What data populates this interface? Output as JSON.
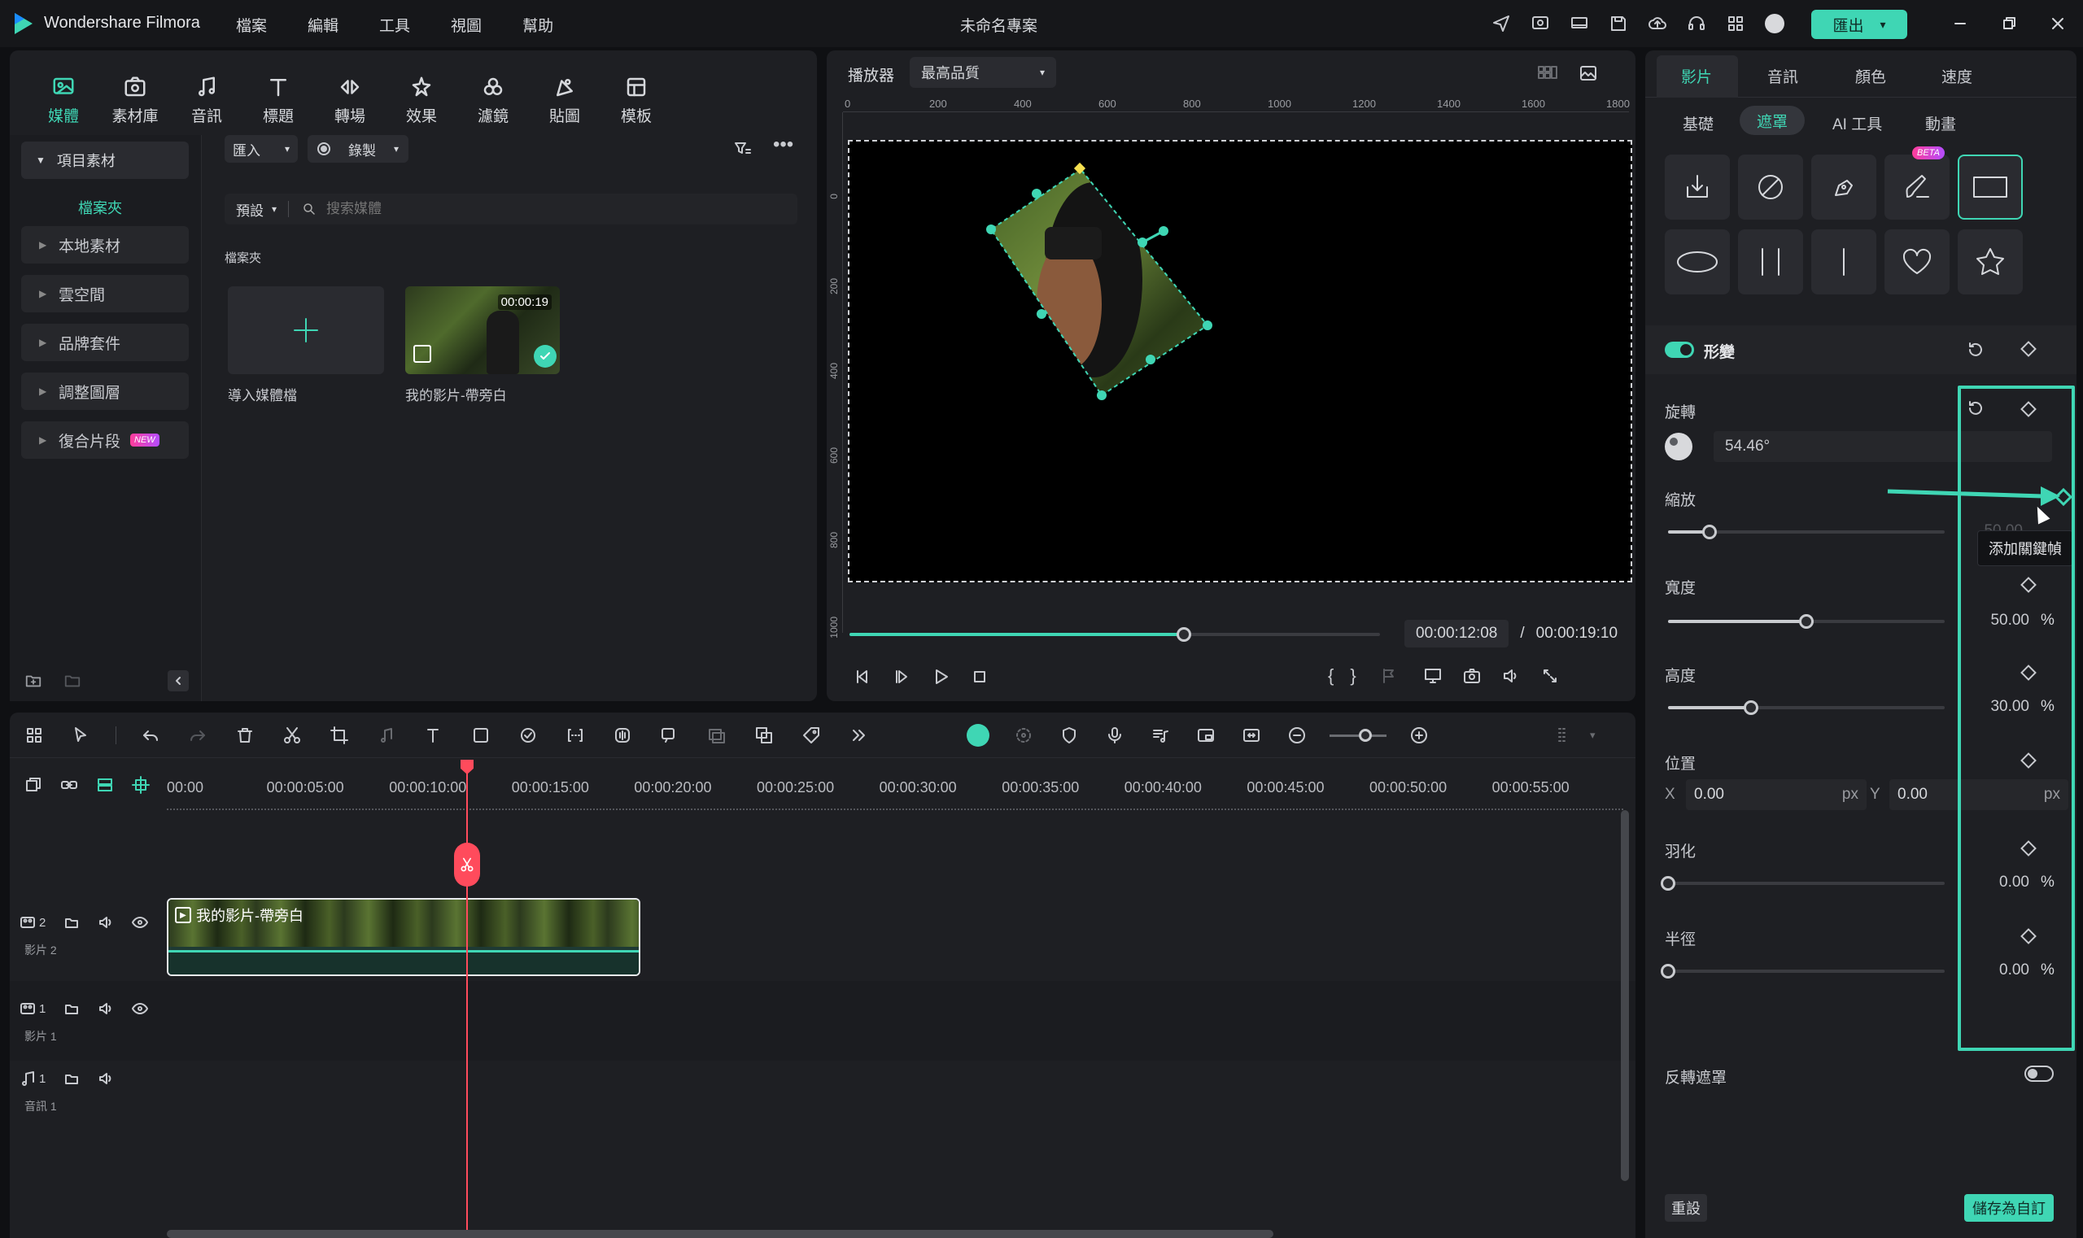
{
  "app": {
    "name": "Wondershare Filmora",
    "project_title": "未命名專案",
    "export_label": "匯出",
    "menus": [
      "檔案",
      "編輯",
      "工具",
      "視圖",
      "幫助"
    ]
  },
  "toolbar": {
    "items": [
      {
        "label": "媒體",
        "icon": "media-icon"
      },
      {
        "label": "素材庫",
        "icon": "library-icon"
      },
      {
        "label": "音訊",
        "icon": "music-icon"
      },
      {
        "label": "標題",
        "icon": "title-icon"
      },
      {
        "label": "轉場",
        "icon": "transition-icon"
      },
      {
        "label": "效果",
        "icon": "effects-icon"
      },
      {
        "label": "濾鏡",
        "icon": "filter-icon"
      },
      {
        "label": "貼圖",
        "icon": "sticker-icon"
      },
      {
        "label": "模板",
        "icon": "template-icon"
      }
    ]
  },
  "sidebar": {
    "project_media": "項目素材",
    "folder": "檔案夾",
    "items": [
      "本地素材",
      "雲空間",
      "品牌套件",
      "調整圖層",
      "復合片段"
    ],
    "new_badge": "NEW"
  },
  "media": {
    "import_label": "匯入",
    "record_label": "錄製",
    "sort_label": "預設",
    "search_placeholder": "搜索媒體",
    "folder_heading": "檔案夾",
    "import_tile": "導入媒體檔",
    "clip_name": "我的影片-帶旁白",
    "clip_duration": "00:00:19"
  },
  "player": {
    "label": "播放器",
    "quality": "最高品質",
    "current_time": "00:00:12:08",
    "total_time": "00:00:19:10",
    "separator": "/",
    "progress": 0.63,
    "ruler_h": [
      "0",
      "200",
      "400",
      "600",
      "800",
      "1000",
      "1200",
      "1400",
      "1600",
      "1800"
    ],
    "ruler_v": [
      "0",
      "200",
      "400",
      "600",
      "800",
      "1000"
    ]
  },
  "timeline": {
    "ticks": [
      "00:00",
      "00:00:05:00",
      "00:00:10:00",
      "00:00:15:00",
      "00:00:20:00",
      "00:00:25:00",
      "00:00:30:00",
      "00:00:35:00",
      "00:00:40:00",
      "00:00:45:00",
      "00:00:50:00",
      "00:00:55:00"
    ],
    "tracks": [
      {
        "num": "2",
        "name": "影片 2"
      },
      {
        "num": "1",
        "name": "影片 1"
      },
      {
        "num": "1",
        "name": "音訊 1"
      }
    ],
    "clip_label": "我的影片-帶旁白"
  },
  "inspector": {
    "tabs": [
      "影片",
      "音訊",
      "顏色",
      "速度"
    ],
    "subtabs": [
      "基礎",
      "遮罩",
      "AI 工具",
      "動畫"
    ],
    "beta": "BETA",
    "section": "形變",
    "rotate": {
      "label": "旋轉",
      "value": "54.46°"
    },
    "scale": {
      "label": "縮放",
      "value": "50.00",
      "level": 0.15
    },
    "width": {
      "label": "寬度",
      "value": "50.00",
      "unit": "%",
      "level": 0.5
    },
    "height": {
      "label": "高度",
      "value": "30.00",
      "unit": "%",
      "level": 0.3
    },
    "position": {
      "label": "位置",
      "x_label": "X",
      "x": "0.00",
      "y_label": "Y",
      "y": "0.00",
      "unit": "px"
    },
    "feather": {
      "label": "羽化",
      "value": "0.00",
      "unit": "%",
      "level": 0
    },
    "radius": {
      "label": "半徑",
      "value": "0.00",
      "unit": "%",
      "level": 0
    },
    "invert": "反轉遮罩",
    "tooltip": "添加關鍵幀",
    "reset": "重設",
    "save": "儲存為自訂"
  },
  "colors": {
    "accent": "#3fd6b4",
    "playhead": "#ff4b5c"
  }
}
